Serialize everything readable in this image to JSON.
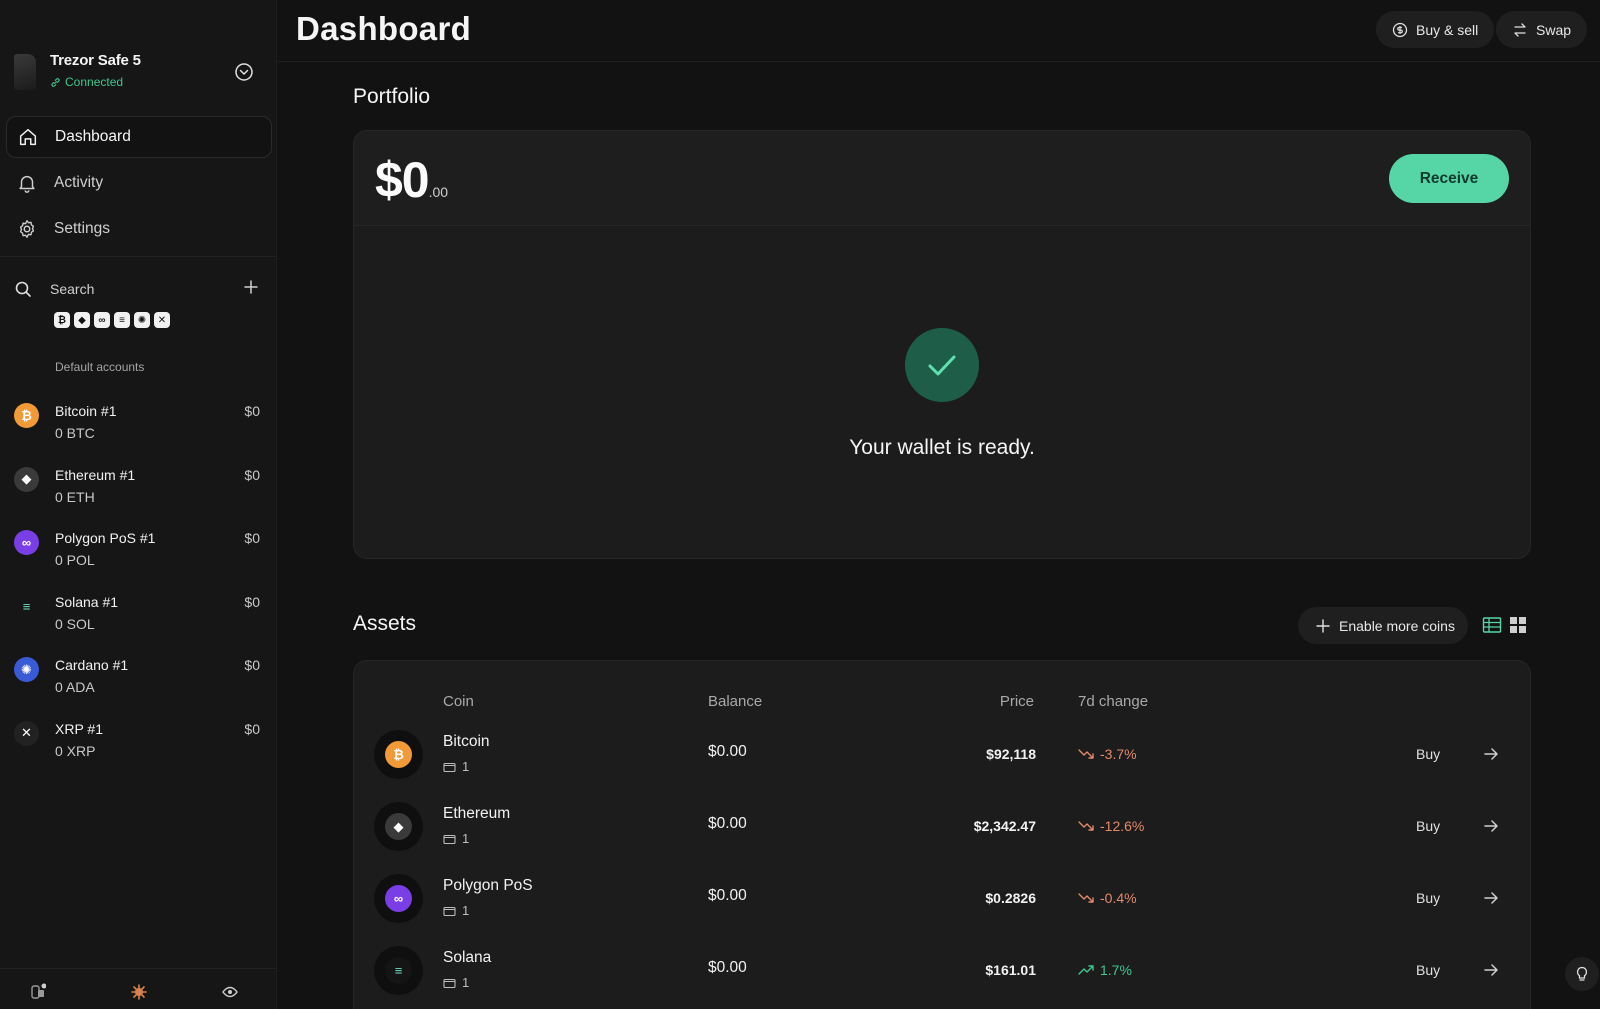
{
  "device": {
    "name": "Trezor Safe 5",
    "status": "Connected"
  },
  "nav": [
    {
      "label": "Dashboard",
      "icon": "home-icon",
      "active": true
    },
    {
      "label": "Activity",
      "icon": "bell-icon"
    },
    {
      "label": "Settings",
      "icon": "gear-icon"
    }
  ],
  "search": {
    "label": "Search"
  },
  "coin_filters": [
    "₿",
    "◆",
    "∞",
    "≡",
    "✺",
    "✕"
  ],
  "accounts_group": "Default accounts",
  "accounts": [
    {
      "name": "Bitcoin #1",
      "balance": "0 BTC",
      "fiat": "$0",
      "color": "#f29a38",
      "glyph": "₿"
    },
    {
      "name": "Ethereum #1",
      "balance": "0 ETH",
      "fiat": "$0",
      "color": "#3a3a3a",
      "glyph": "◆"
    },
    {
      "name": "Polygon PoS #1",
      "balance": "0 POL",
      "fiat": "$0",
      "color": "#7a3ee6",
      "glyph": "∞"
    },
    {
      "name": "Solana #1",
      "balance": "0 SOL",
      "fiat": "$0",
      "color": "#161616",
      "glyph": "≡"
    },
    {
      "name": "Cardano #1",
      "balance": "0 ADA",
      "fiat": "$0",
      "color": "#3a5bd6",
      "glyph": "✺"
    },
    {
      "name": "XRP #1",
      "balance": "0 XRP",
      "fiat": "$0",
      "color": "#222222",
      "glyph": "✕"
    }
  ],
  "header": {
    "title": "Dashboard",
    "buy_sell": "Buy & sell",
    "swap": "Swap"
  },
  "portfolio": {
    "title": "Portfolio",
    "value_main": "$0",
    "value_cents": ".00",
    "receive": "Receive",
    "ready_text": "Your wallet is ready."
  },
  "assets": {
    "title": "Assets",
    "enable_more": "Enable more coins",
    "columns": {
      "coin": "Coin",
      "balance": "Balance",
      "price": "Price",
      "change": "7d change"
    },
    "rows": [
      {
        "name": "Bitcoin",
        "accounts": "1",
        "balance": "$0.00",
        "price": "$92,118",
        "change": "-3.7%",
        "trend": "down",
        "buy": "Buy",
        "color": "#f29a38",
        "glyph": "₿"
      },
      {
        "name": "Ethereum",
        "accounts": "1",
        "balance": "$0.00",
        "price": "$2,342.47",
        "change": "-12.6%",
        "trend": "down",
        "buy": "Buy",
        "color": "#3a3a3a",
        "glyph": "◆"
      },
      {
        "name": "Polygon PoS",
        "accounts": "1",
        "balance": "$0.00",
        "price": "$0.2826",
        "change": "-0.4%",
        "trend": "down",
        "buy": "Buy",
        "color": "#7a3ee6",
        "glyph": "∞"
      },
      {
        "name": "Solana",
        "accounts": "1",
        "balance": "$0.00",
        "price": "$161.01",
        "change": "1.7%",
        "trend": "up",
        "buy": "Buy",
        "color": "#151515",
        "glyph": "≡"
      }
    ]
  },
  "colors": {
    "accent": "#56d6a6",
    "success": "#3fc78e",
    "negative": "#e28a6a",
    "positive": "#3fc78e"
  }
}
